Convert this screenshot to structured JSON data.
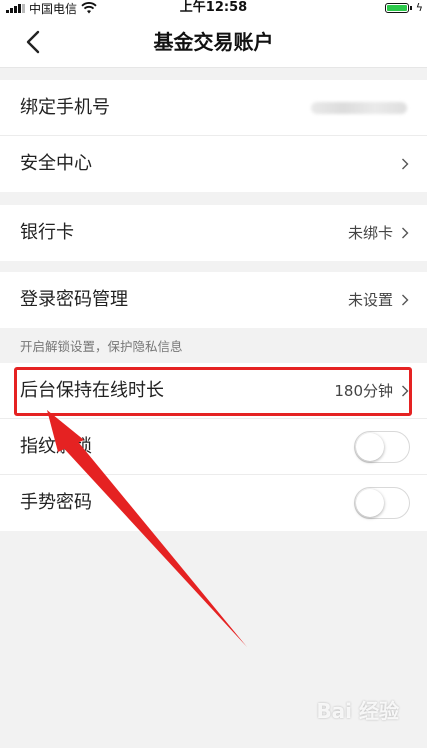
{
  "status_bar": {
    "carrier": "中国电信",
    "time": "上午12:58"
  },
  "nav": {
    "title": "基金交易账户"
  },
  "list": {
    "phone_label": "绑定手机号",
    "security_label": "安全中心",
    "bank_label": "银行卡",
    "bank_value": "未绑卡",
    "password_label": "登录密码管理",
    "password_value": "未设置",
    "section_note": "开启解锁设置，保护隐私信息",
    "online_label": "后台保持在线时长",
    "online_value": "180分钟",
    "fingerprint_label": "指纹解锁",
    "gesture_label": "手势密码"
  },
  "toggles": {
    "fingerprint_on": false,
    "gesture_on": false
  },
  "watermark": "Bai 经验",
  "colors": {
    "annotation": "#e52222",
    "battery": "#2cc94b"
  }
}
